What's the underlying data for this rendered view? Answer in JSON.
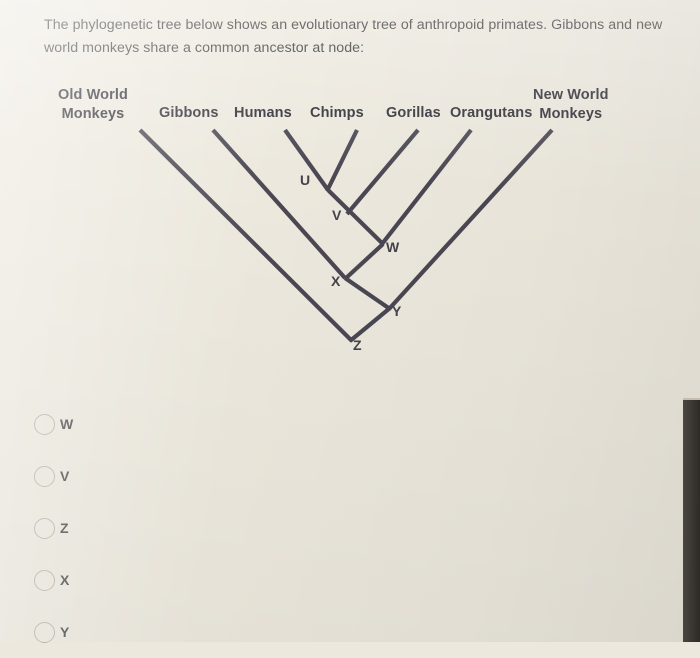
{
  "question": {
    "text": "The phylogenetic tree below shows an evolutionary tree of anthropoid primates. Gibbons and new world monkeys share a common ancestor at node:"
  },
  "figure": {
    "taxa": [
      {
        "id": "old-world-monkeys",
        "label_line1": "Old World",
        "label_line2": "Monkeys"
      },
      {
        "id": "gibbons",
        "label": "Gibbons"
      },
      {
        "id": "humans",
        "label": "Humans"
      },
      {
        "id": "chimps",
        "label": "Chimps"
      },
      {
        "id": "gorillas",
        "label": "Gorillas"
      },
      {
        "id": "orangutans",
        "label": "Orangutans"
      },
      {
        "id": "new-world-monkeys",
        "label_line1": "New World",
        "label_line2": "Monkeys"
      }
    ],
    "nodes": [
      {
        "id": "U",
        "label": "U"
      },
      {
        "id": "V",
        "label": "V"
      },
      {
        "id": "W",
        "label": "W"
      },
      {
        "id": "X",
        "label": "X"
      },
      {
        "id": "Y",
        "label": "Y"
      },
      {
        "id": "Z",
        "label": "Z"
      }
    ],
    "line_color": "#4a4752"
  },
  "options": [
    {
      "id": "opt-w",
      "label": "W",
      "selected": false
    },
    {
      "id": "opt-v",
      "label": "V",
      "selected": false
    },
    {
      "id": "opt-z",
      "label": "Z",
      "selected": false
    },
    {
      "id": "opt-x",
      "label": "X",
      "selected": false
    },
    {
      "id": "opt-y",
      "label": "Y",
      "selected": false
    }
  ],
  "colors": {
    "page_background": "#ece8dd",
    "text": "#3c3c3c",
    "tree_stroke": "#4a4752",
    "radio_border": "#b8b2aa",
    "dark_edge": "#3b3631"
  }
}
